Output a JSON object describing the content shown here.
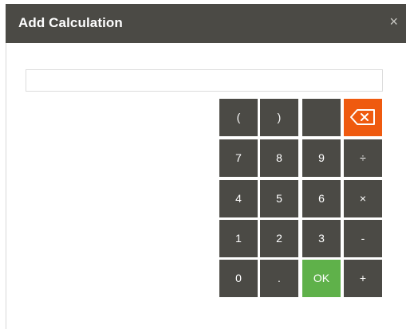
{
  "dialog": {
    "title": "Add Calculation",
    "close_symbol": "×"
  },
  "input": {
    "value": "",
    "placeholder": ""
  },
  "keypad": {
    "rows": [
      [
        "(",
        ")",
        "",
        "backspace"
      ],
      [
        "7",
        "8",
        "9",
        "÷"
      ],
      [
        "4",
        "5",
        "6",
        "×"
      ],
      [
        "1",
        "2",
        "3",
        "-"
      ],
      [
        "0",
        ".",
        "OK",
        "+"
      ]
    ],
    "colors": {
      "key_bg": "#4b4a45",
      "ok_bg": "#5fb14a",
      "backspace_bg": "#ef5a0f"
    },
    "backspace_icon": "backspace-icon"
  }
}
